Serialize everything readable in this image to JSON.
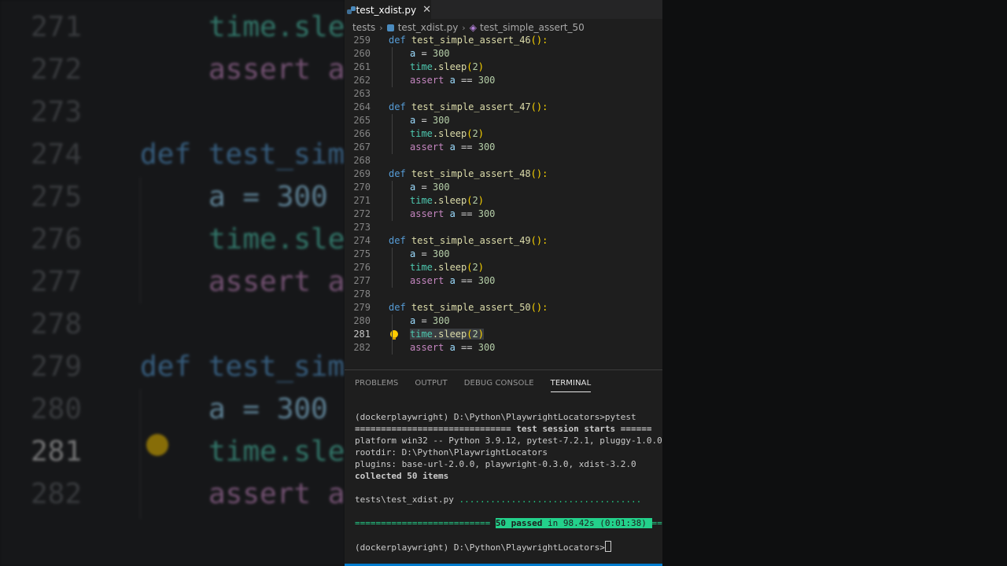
{
  "background": {
    "lines": [
      {
        "num": "271",
        "code": "time.sle"
      },
      {
        "num": "272",
        "code": "assert a"
      },
      {
        "num": "273",
        "code": ""
      },
      {
        "num": "274",
        "code": "def test_simp"
      },
      {
        "num": "275",
        "code": "a = 300"
      },
      {
        "num": "276",
        "code": "time.sle"
      },
      {
        "num": "277",
        "code": "assert a"
      },
      {
        "num": "278",
        "code": ""
      },
      {
        "num": "279",
        "code": "def test_sim"
      },
      {
        "num": "280",
        "code": "a = 300"
      },
      {
        "num": "281",
        "code": "time.sle"
      },
      {
        "num": "282",
        "code": "assert a"
      }
    ]
  },
  "tab": {
    "filename": "test_xdist.py",
    "close": "✕"
  },
  "breadcrumbs": {
    "folder": "tests",
    "file": "test_xdist.py",
    "symbol": "test_simple_assert_50"
  },
  "editor": {
    "lines": [
      {
        "num": "259",
        "kind": "def",
        "name": "test_simple_assert_46"
      },
      {
        "num": "260",
        "kind": "assign"
      },
      {
        "num": "261",
        "kind": "sleep"
      },
      {
        "num": "262",
        "kind": "assert"
      },
      {
        "num": "263",
        "kind": "blank"
      },
      {
        "num": "264",
        "kind": "def",
        "name": "test_simple_assert_47"
      },
      {
        "num": "265",
        "kind": "assign"
      },
      {
        "num": "266",
        "kind": "sleep"
      },
      {
        "num": "267",
        "kind": "assert"
      },
      {
        "num": "268",
        "kind": "blank"
      },
      {
        "num": "269",
        "kind": "def",
        "name": "test_simple_assert_48"
      },
      {
        "num": "270",
        "kind": "assign"
      },
      {
        "num": "271",
        "kind": "sleep"
      },
      {
        "num": "272",
        "kind": "assert"
      },
      {
        "num": "273",
        "kind": "blank"
      },
      {
        "num": "274",
        "kind": "def",
        "name": "test_simple_assert_49"
      },
      {
        "num": "275",
        "kind": "assign"
      },
      {
        "num": "276",
        "kind": "sleep"
      },
      {
        "num": "277",
        "kind": "assert"
      },
      {
        "num": "278",
        "kind": "blank"
      },
      {
        "num": "279",
        "kind": "def",
        "name": "test_simple_assert_50"
      },
      {
        "num": "280",
        "kind": "assign"
      },
      {
        "num": "281",
        "kind": "sleep",
        "active": true
      },
      {
        "num": "282",
        "kind": "assert"
      }
    ],
    "tokens": {
      "def": "def",
      "parens_colon": "():",
      "var": "a",
      "eq": " = ",
      "value": "300",
      "module": "time",
      "method": ".sleep",
      "sleep_open": "(",
      "sleep_arg": "2",
      "sleep_close": ")",
      "assert": "assert",
      "eqeq": " == "
    }
  },
  "panel": {
    "tabs": [
      "PROBLEMS",
      "OUTPUT",
      "DEBUG CONSOLE",
      "TERMINAL"
    ],
    "active_tab": "TERMINAL"
  },
  "terminal": {
    "cmd_line": "(dockerplaywright) D:\\Python\\PlaywrightLocators>pytest",
    "session_sep": "============================== ",
    "session_title": "test session starts",
    "session_sep_tail": " ======",
    "platform": "platform win32 -- Python 3.9.12, pytest-7.2.1, pluggy-1.0.0",
    "rootdir": "rootdir: D:\\Python\\PlaywrightLocators",
    "plugins": "plugins: base-url-2.0.0, playwright-0.3.0, xdist-3.2.0",
    "collected": "collected 50 items",
    "test_file": "tests\\test_xdist.py ",
    "dots": "...................................",
    "result_sep": "========================== ",
    "result_passed": "50 passed",
    "result_time": " in 98.42s (0:01:38) ",
    "result_sep_tail": "==",
    "prompt": "(dockerplaywright) D:\\Python\\PlaywrightLocators>"
  }
}
